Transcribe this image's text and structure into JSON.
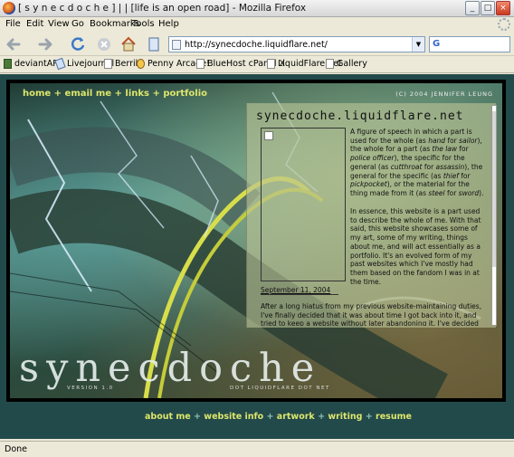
{
  "window": {
    "title": "[ s y n e c d o c h e ] | |   [life is an open road] - Mozilla Firefox",
    "buttons": [
      "_",
      "□",
      "×"
    ]
  },
  "menu": [
    "File",
    "Edit",
    "View",
    "Go",
    "Bookmarks",
    "Tools",
    "Help"
  ],
  "address": {
    "url": "http://synecdoche.liquidflare.net/"
  },
  "search": {
    "engine_icon": "G"
  },
  "bookmarks": [
    "deviantART",
    "Livejournal",
    "Berrik",
    "Penny Arcade!",
    "BlueHost cPanel X",
    "LiquidFlare.net",
    "Gallery"
  ],
  "site": {
    "nav": [
      "home",
      "email me",
      "links",
      "portfolio"
    ],
    "nav_sep": " + ",
    "copyright": "(C) 2004 JENNIFER LEUNG",
    "big_title": "synecdoche",
    "version": "VERSION 1.0",
    "dotnet": "DOT LIQUIDFLARE DOT NET",
    "panel_title": "synecdoche.liquidflare.net",
    "intro": {
      "pre": "A figure of speech in which a part is used for the whole (as ",
      "ex1": "hand",
      "mid1": " for ",
      "ex2": "sailor",
      "mid2": "), the whole for a part (as ",
      "ex3": "the law",
      "mid3": " for ",
      "ex4": "police officer",
      "mid4": "), the specific for the general (as ",
      "ex5": "cutthroat",
      "mid5": " for ",
      "ex6": "assassin",
      "mid6": "), the general for the specific (as ",
      "ex7": "thief",
      "mid7": " for ",
      "ex8": "pickpocket",
      "mid8": "), or the material for the thing made from it (as ",
      "ex9": "steel",
      "mid9": " for ",
      "ex10": "sword",
      "post": ")."
    },
    "para2": "In essence, this website is a part used to describe the whole of me. With that said, this website showcases some of my art, some of my writing, things about me, and will act essentially as a portfolio. It's an evolved form of my past websites which I've mostly had them based on the fandom I was in at the time.",
    "date": "September 11, 2004",
    "story": "After a long hiatus from my previous website-maintaining duties, I've finally decided that it was about time I got back into it, and tried to keep a website without later abandoning it. I've decided after that I wanted to make this a little more serious, a little more grown up, something to show that I've",
    "bottom_nav": [
      "about me",
      "website info",
      "artwork",
      "writing",
      "resume"
    ],
    "bottom_sep": "+"
  },
  "status": {
    "text": "Done"
  }
}
